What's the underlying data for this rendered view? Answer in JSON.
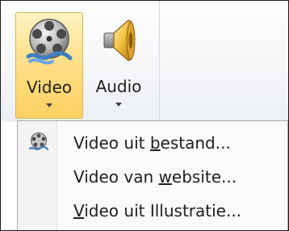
{
  "ribbon": {
    "video": {
      "label": "Video",
      "icon": "film-reel-icon"
    },
    "audio": {
      "label": "Audio",
      "icon": "speaker-icon"
    }
  },
  "menu": {
    "items": [
      {
        "prefix": "Video uit ",
        "accel": "b",
        "suffix": "estand...",
        "icon": "film-reel-icon"
      },
      {
        "prefix": "Video van ",
        "accel": "w",
        "suffix": "ebsite...",
        "icon": ""
      },
      {
        "prefix": "",
        "accel": "V",
        "suffix": "ideo uit Illustratie...",
        "icon": ""
      }
    ]
  },
  "colors": {
    "selected_gradient_top": "#fff4c4",
    "selected_gradient_bottom": "#fdd162",
    "selected_border": "#d7b54c",
    "menu_border": "#a7abb0"
  }
}
